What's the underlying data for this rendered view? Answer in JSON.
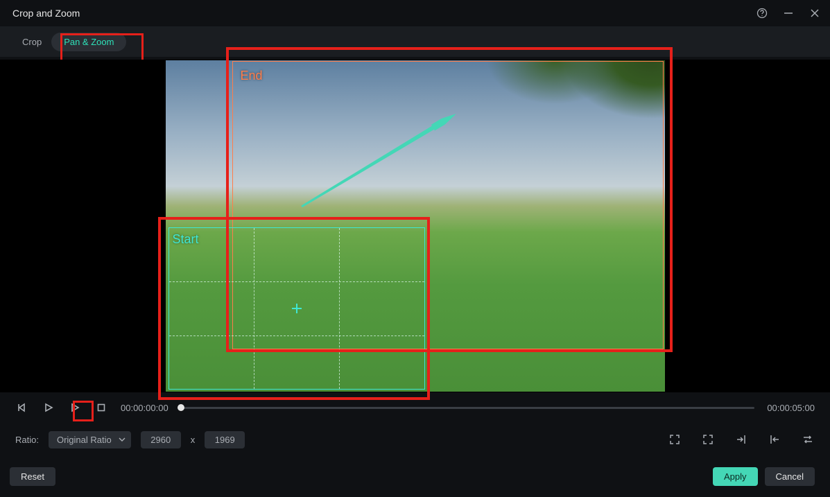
{
  "window": {
    "title": "Crop and Zoom"
  },
  "tabs": {
    "crop": "Crop",
    "pan_zoom": "Pan & Zoom"
  },
  "preview": {
    "start_label": "Start",
    "end_label": "End"
  },
  "transport": {
    "current_time": "00:00:00:00",
    "total_time": "00:00:05:00"
  },
  "ratio": {
    "label": "Ratio:",
    "selected": "Original Ratio",
    "width": "2960",
    "separator": "x",
    "height": "1969"
  },
  "footer": {
    "reset": "Reset",
    "apply": "Apply",
    "cancel": "Cancel"
  }
}
